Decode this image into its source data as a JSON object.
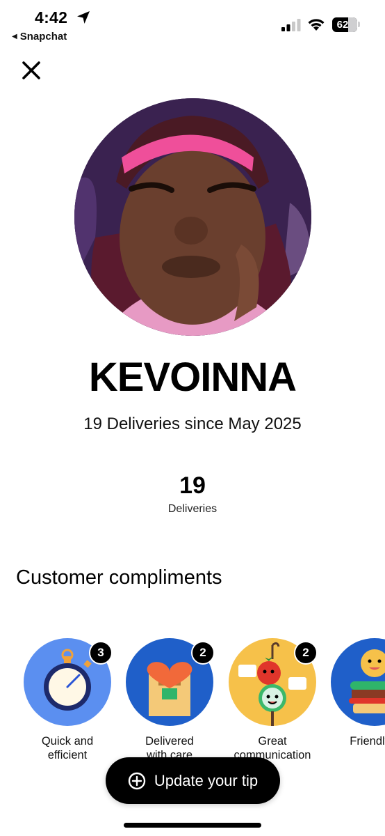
{
  "status_bar": {
    "time": "4:42",
    "back_app": "Snapchat",
    "battery": "62"
  },
  "profile": {
    "name": "KEVOINNA",
    "since": "19 Deliveries since May 2025",
    "stat_value": "19",
    "stat_label": "Deliveries"
  },
  "compliments": {
    "title": "Customer compliments",
    "items": [
      {
        "label_line1": "Quick and",
        "label_line2": "efficient",
        "count": "3",
        "icon": "stopwatch-icon",
        "color": "#5b8ff0"
      },
      {
        "label_line1": "Delivered",
        "label_line2": "with care",
        "count": "2",
        "icon": "heart-package-icon",
        "color": "#1f5fc9"
      },
      {
        "label_line1": "Great",
        "label_line2": "communication",
        "count": "2",
        "icon": "tomato-chat-icon",
        "color": "#f6c14a"
      },
      {
        "label_line1": "Friendly s",
        "label_line2": "",
        "count": "",
        "icon": "smiling-burger-icon",
        "color": "#1f5fc9"
      }
    ]
  },
  "tip_button": {
    "label": "Update your tip"
  }
}
